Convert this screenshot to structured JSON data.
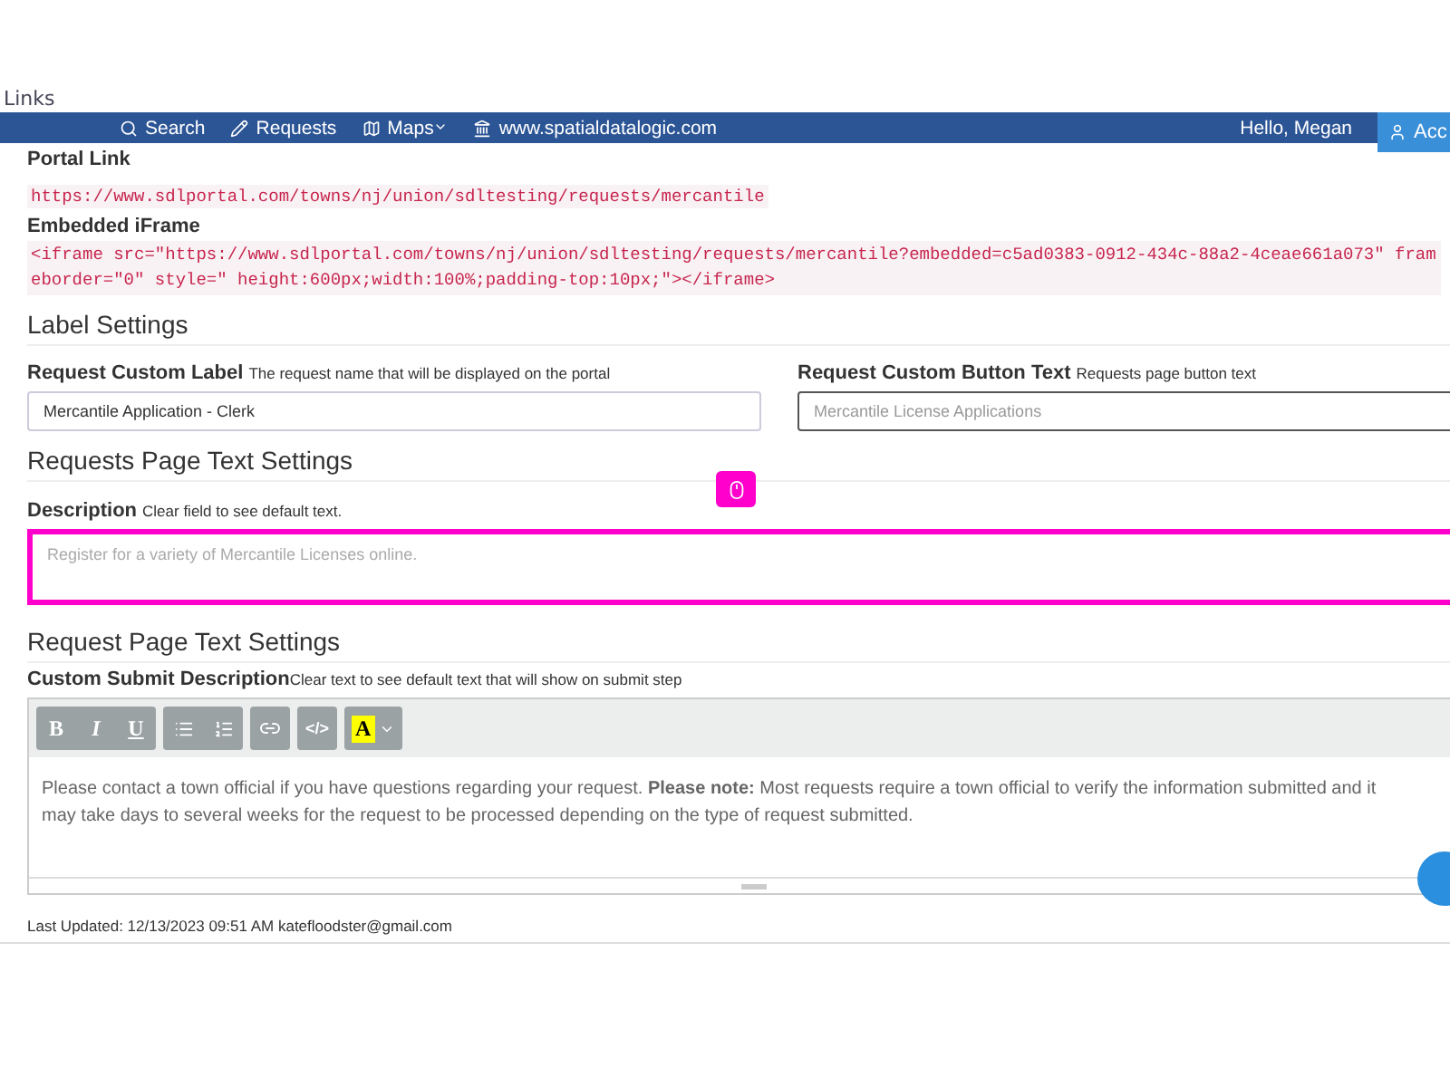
{
  "navbar": {
    "hidden_title": "Links",
    "items": [
      {
        "label": "Search",
        "dropdown": false
      },
      {
        "label": "Requests",
        "dropdown": false
      },
      {
        "label": "Maps",
        "dropdown": true
      },
      {
        "label": "www.spatialdatalogic.com",
        "dropdown": false
      }
    ],
    "greeting": "Hello, Megan",
    "account_button": "Acc"
  },
  "links": [
    {
      "label": "Portal Link",
      "code": "https://www.sdlportal.com/towns/nj/union/sdltesting/requests/mercantile"
    },
    {
      "label": "Embedded iFrame",
      "code": "<iframe src=\"https://www.sdlportal.com/towns/nj/union/sdltesting/requests/mercantile?embedded=c5ad0383-0912-434c-88a2-4ceae661a073\" frameborder=\"0\" style=\" height:600px;width:100%;padding-top:10px;\"></iframe>"
    }
  ],
  "label_settings": {
    "title": "Label Settings",
    "fields": [
      {
        "label": "Request Custom Label",
        "hint": "The request name that will be displayed on the portal",
        "value": "Mercantile Application - Clerk",
        "focused": false
      },
      {
        "label": "Request Custom Button Text",
        "hint": "Requests page button text",
        "placeholder": "Mercantile License Applications",
        "focused": true
      }
    ]
  },
  "requests_page": {
    "title": "Requests Page Text Settings",
    "label": "Description",
    "hint": "Clear field to see default text.",
    "placeholder": "Register for a variety of Mercantile Licenses online.",
    "highlighted": true
  },
  "request_page": {
    "title": "Request Page Text Settings",
    "label": "Custom Submit Description",
    "hint": "Clear text to see default text that will show on submit step",
    "toolbar": {
      "bold": "B",
      "italic": "I",
      "underline": "U",
      "code": "</>",
      "highlight": "A"
    },
    "content": "Please contact a town official if you have questions regarding your request. **Please note:** Most requests require a town official to verify the information submitted and it may take days to several weeks for the request to be processed depending on the type of request submitted."
  },
  "footer": "Last Updated: 12/13/2023 09:51 AM katefloodster@gmail.com"
}
